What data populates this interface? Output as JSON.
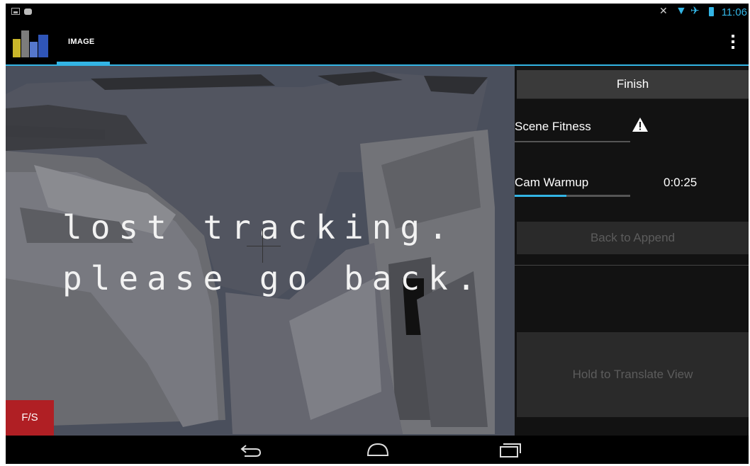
{
  "status_bar": {
    "time": "11:06",
    "icons": [
      "gallery-icon",
      "game-controller-icon",
      "mute-icon",
      "wifi-icon",
      "airplane-icon",
      "battery-icon"
    ]
  },
  "action_bar": {
    "tab_label": "IMAGE",
    "icons": [
      "app-logo-icon",
      "overflow-menu-icon"
    ]
  },
  "viewport": {
    "message": "lost tracking.\nplease go back.",
    "fs_label": "F/S"
  },
  "side_panel": {
    "finish_label": "Finish",
    "scene_fitness_label": "Scene Fitness",
    "scene_fitness_status_icon": "warning-icon",
    "cam_warmup_label": "Cam Warmup",
    "cam_warmup_time": "0:0:25",
    "cam_warmup_progress": 0.45,
    "back_to_append_label": "Back to Append",
    "hold_to_translate_label": "Hold to Translate View"
  },
  "nav_bar": {
    "icons": [
      "back-icon",
      "home-icon",
      "recents-icon"
    ]
  },
  "colors": {
    "accent": "#33b5e5",
    "fs_button": "#b01f24",
    "viewport_bg": "#4a4f5c",
    "panel_bg": "#121212"
  }
}
